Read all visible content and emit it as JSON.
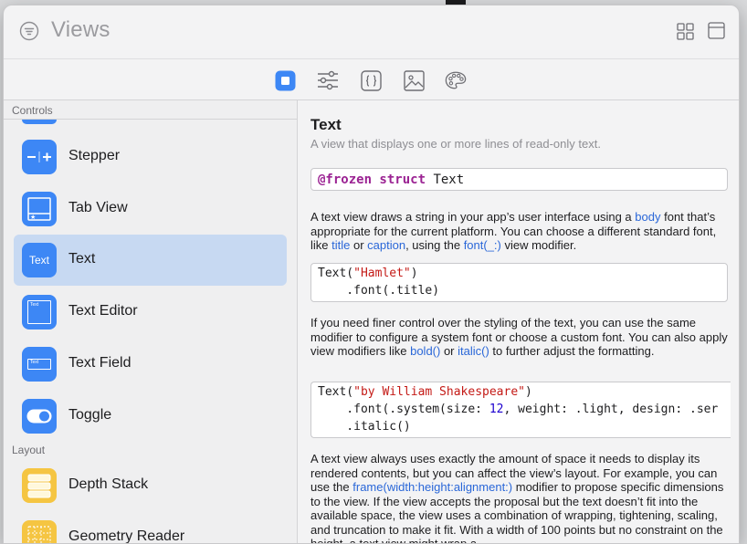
{
  "window": {
    "title": "Views"
  },
  "tabs": [
    {
      "name": "tab-views",
      "active": true
    },
    {
      "name": "tab-modifiers",
      "active": false
    },
    {
      "name": "tab-snippets",
      "active": false
    },
    {
      "name": "tab-media",
      "active": false
    },
    {
      "name": "tab-colors",
      "active": false
    }
  ],
  "sidebar": {
    "section_controls": "Controls",
    "section_layout": "Layout",
    "items": [
      {
        "label": "Stepper",
        "icon": "stepper-icon"
      },
      {
        "label": "Tab View",
        "icon": "tab-view-icon"
      },
      {
        "label": "Text",
        "icon": "text-icon",
        "selected": true,
        "icon_text": "Text"
      },
      {
        "label": "Text Editor",
        "icon": "text-editor-icon",
        "icon_text": "Text"
      },
      {
        "label": "Text Field",
        "icon": "text-field-icon",
        "icon_text": "Text"
      },
      {
        "label": "Toggle",
        "icon": "toggle-icon"
      },
      {
        "label": "Depth Stack",
        "icon": "depth-stack-icon"
      },
      {
        "label": "Geometry Reader",
        "icon": "geometry-reader-icon"
      }
    ]
  },
  "detail": {
    "title": "Text",
    "subtitle": "A view that displays one or more lines of read-only text.",
    "declaration": {
      "keyword": "@frozen struct",
      "name": " Text"
    },
    "para1": {
      "t1": "A text view draws a string in your app’s user interface using a ",
      "l1": "body",
      "t2": " font that’s appropriate for the current platform. You can choose a different standard font, like ",
      "l2": "title",
      "t3": " or ",
      "l3": "caption",
      "t4": ", using the ",
      "l4": "font(_:)",
      "t5": " view modifier."
    },
    "code1": {
      "line1_a": "Text(",
      "line1_str": "\"Hamlet\"",
      "line1_b": ")",
      "line2": "    .font(.title)"
    },
    "para2": {
      "t1": "If you need finer control over the styling of the text, you can use the same modifier to configure a system font or choose a custom font. You can also apply view modifiers like ",
      "l1": "bold()",
      "t2": " or ",
      "l2": "italic()",
      "t3": " to further adjust the formatting."
    },
    "code2": {
      "line1_a": "Text(",
      "line1_str": "\"by William Shakespeare\"",
      "line1_b": ")",
      "line2_a": "    .font(.system(size: ",
      "line2_num": "12",
      "line2_b": ", weight: .light, design: .ser",
      "line3": "    .italic()"
    },
    "para3": {
      "t1": "A text view always uses exactly the amount of space it needs to display its rendered contents, but you can affect the view’s layout. For example, you can use the ",
      "l1": "frame(width:height:alignment:)",
      "t2": " modifier to propose specific dimensions to the view. If the view accepts the proposal but the text doesn’t fit into the available space, the view uses a combination of wrapping, tightening, scaling, and truncation to make it fit. With a width of 100 points but no constraint on the height, a text view might wrap a"
    }
  },
  "colors": {
    "accent": "#3d87f5",
    "selection": "#c7d9f2",
    "link": "#2a67d8",
    "string": "#c41a16",
    "keyword": "#9b2393",
    "number": "#1c00cf"
  }
}
